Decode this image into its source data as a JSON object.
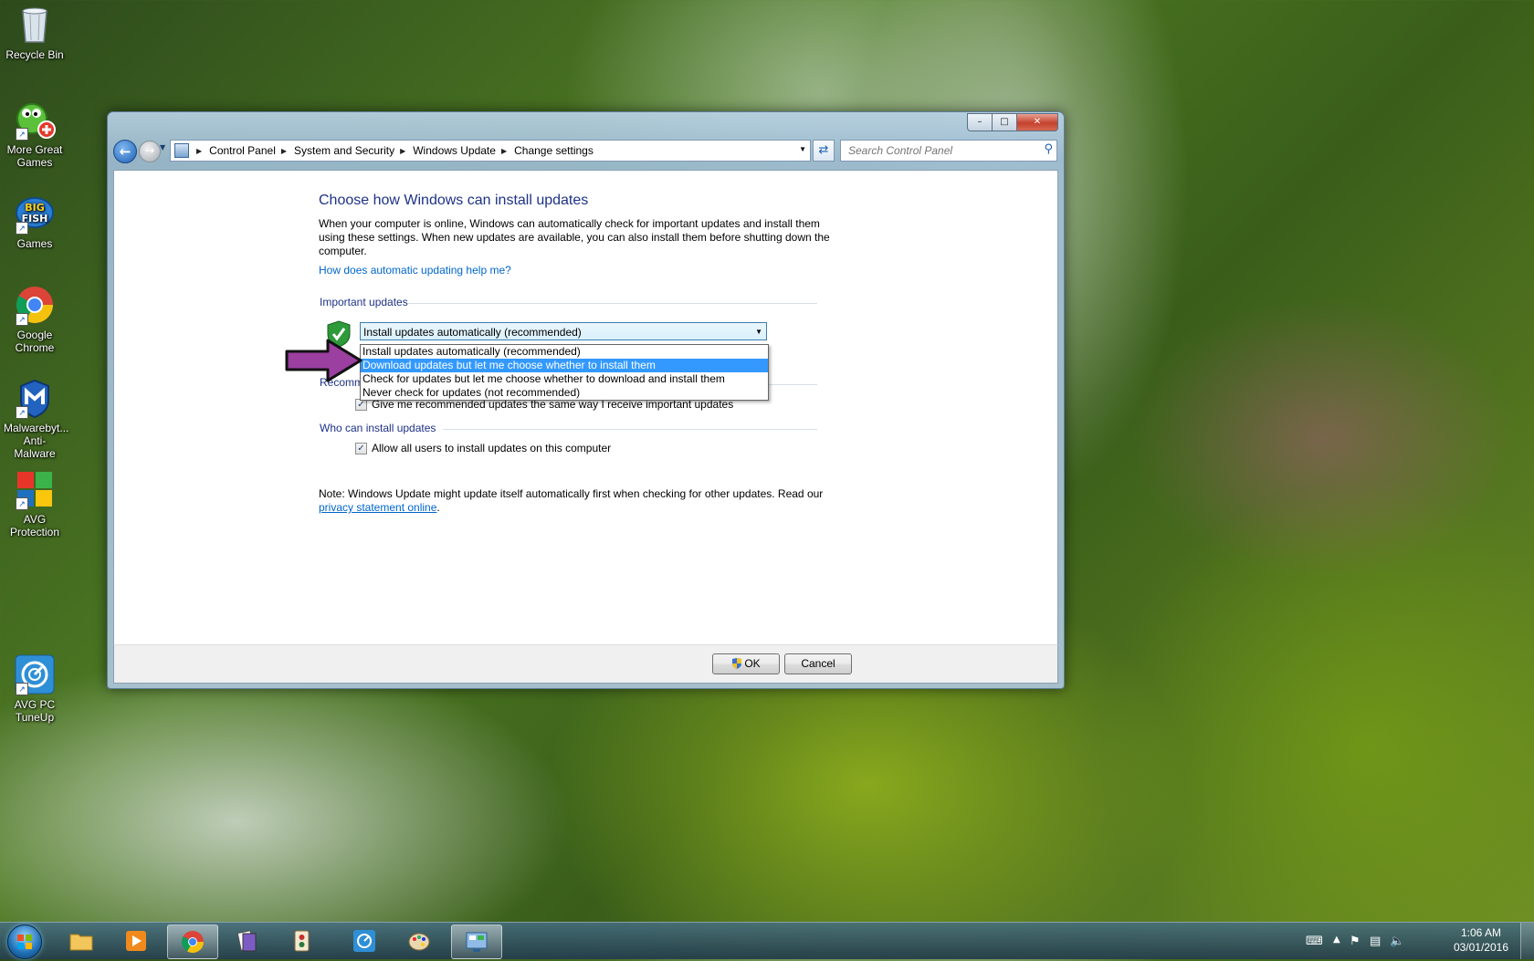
{
  "desktop": {
    "icons": [
      {
        "label": "Recycle Bin"
      },
      {
        "label": "More Great Games"
      },
      {
        "label": "Games"
      },
      {
        "label": "Google Chrome"
      },
      {
        "label": "Malwarebyt... Anti-Malware"
      },
      {
        "label": "AVG Protection"
      },
      {
        "label": "AVG PC TuneUp"
      }
    ]
  },
  "window": {
    "controls": {
      "minimize": "–",
      "maximize": "□",
      "close": "✕"
    },
    "nav": {
      "back": "←",
      "forward": "→",
      "refresh": "⇄"
    },
    "breadcrumb": [
      "Control Panel",
      "System and Security",
      "Windows Update",
      "Change settings"
    ],
    "search": {
      "placeholder": "Search Control Panel"
    },
    "page_title": "Choose how Windows can install updates",
    "intro": "When your computer is online, Windows can automatically check for important updates and install them using these settings. When new updates are available, you can also install them before shutting down the computer.",
    "help_link": "How does automatic updating help me?",
    "important_updates": {
      "label": "Important updates",
      "selected": "Install updates automatically (recommended)",
      "options": [
        "Install updates automatically (recommended)",
        "Download updates but let me choose whether to install them",
        "Check for updates but let me choose whether to download and install them",
        "Never check for updates (not recommended)"
      ],
      "highlighted_index": 1
    },
    "recommended_updates": {
      "label": "Recommended updates",
      "checkbox": "Give me recommended updates the same way I receive important updates",
      "checked": true
    },
    "who_can_install": {
      "label": "Who can install updates",
      "checkbox": "Allow all users to install updates on this computer",
      "checked": true
    },
    "note_text": "Note: Windows Update might update itself automatically first when checking for other updates.  Read our",
    "note_link": "privacy statement online",
    "note_end": ".",
    "buttons": {
      "ok": "OK",
      "cancel": "Cancel"
    }
  },
  "taskbar": {
    "clock_time": "1:06 AM",
    "clock_date": "03/01/2016",
    "tray_expand": "▲"
  },
  "colors": {
    "title_blue": "#1e3287",
    "link_blue": "#0066cc",
    "selection": "#3399ff",
    "arrow_purple": "#9b3fa0"
  }
}
